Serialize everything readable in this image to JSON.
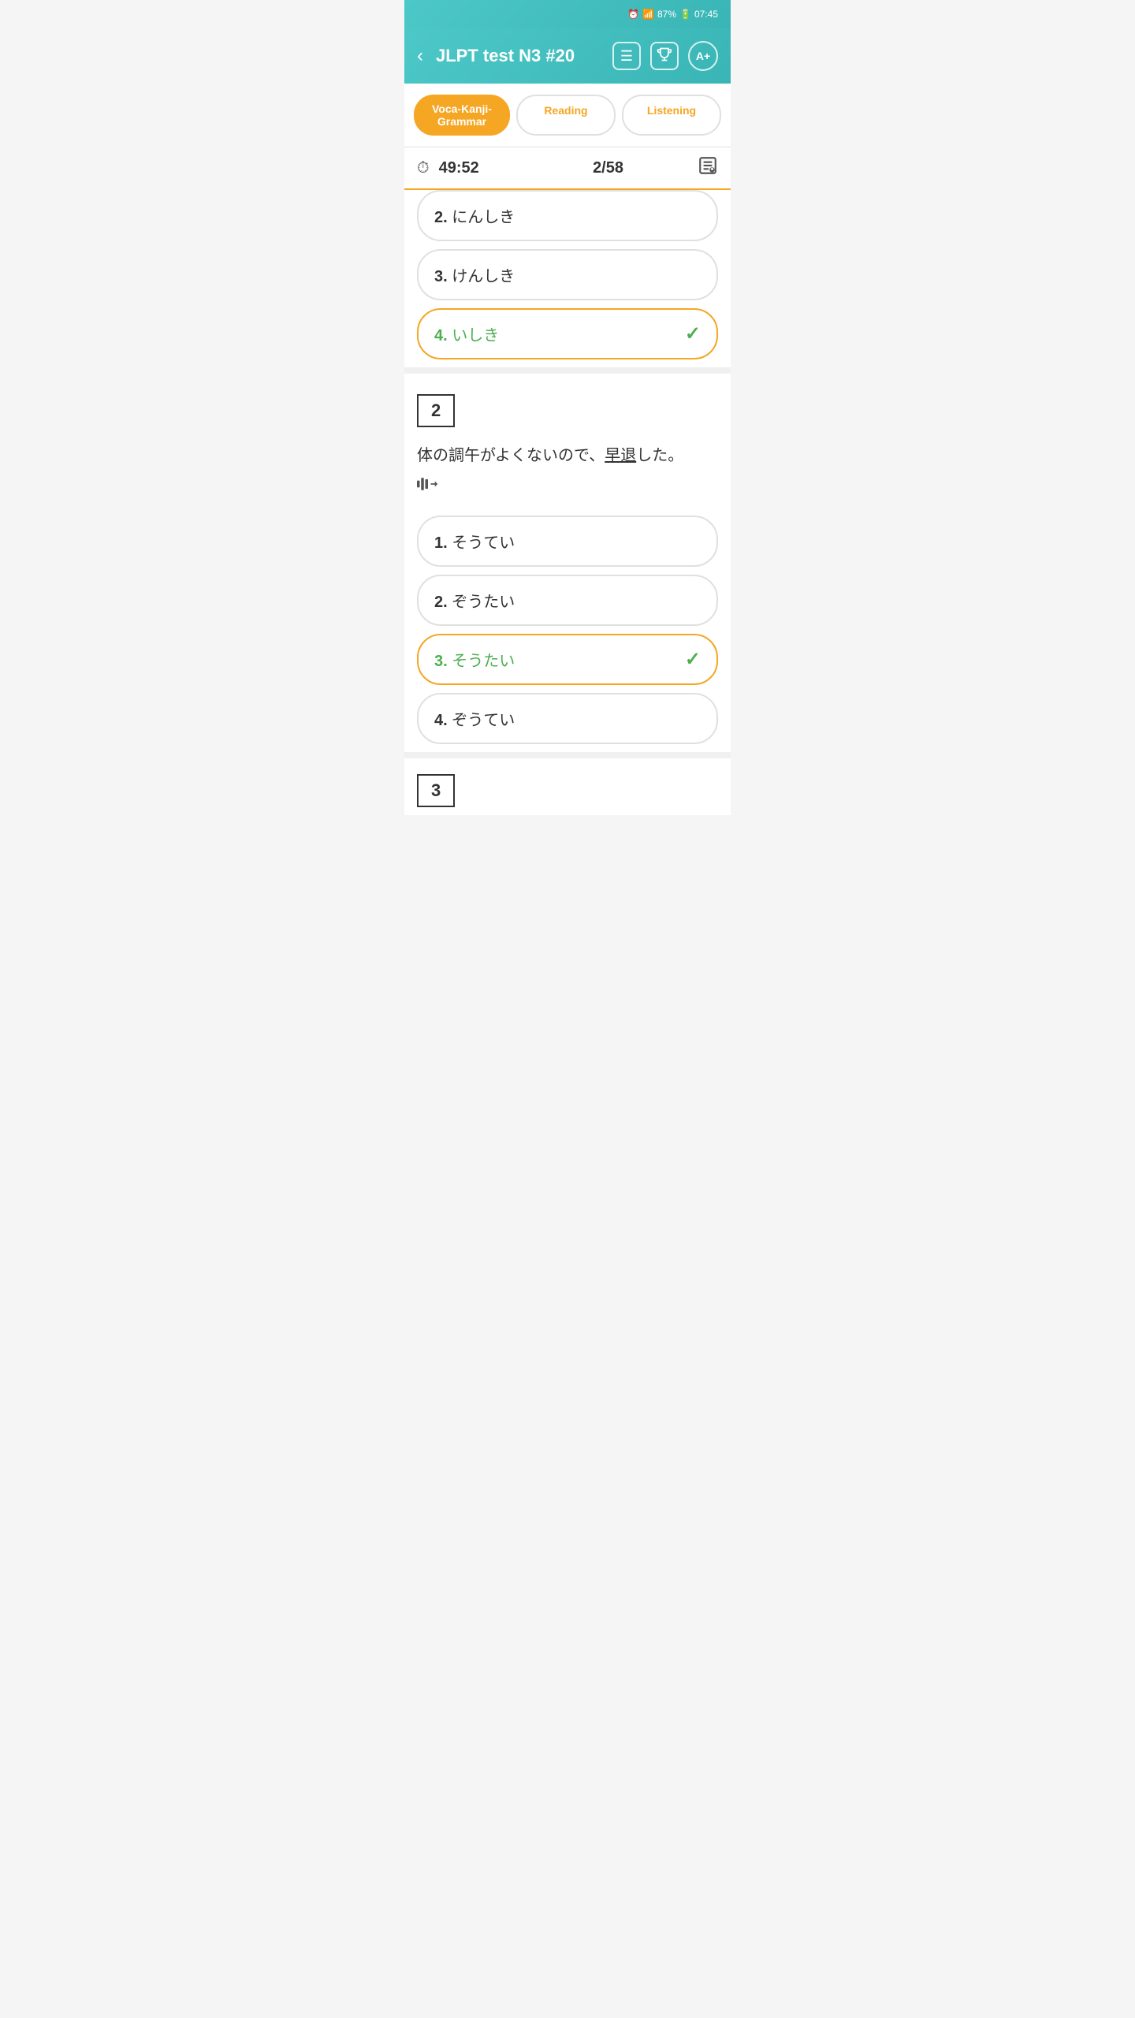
{
  "statusBar": {
    "battery": "87%",
    "time": "07:45"
  },
  "header": {
    "title": "JLPT test N3 #20",
    "backLabel": "<",
    "noteIcon": "≡",
    "trophyIcon": "🏆",
    "fontIcon": "A+"
  },
  "tabs": [
    {
      "label": "Voca-Kanji-Grammar",
      "active": true
    },
    {
      "label": "Reading",
      "active": false
    },
    {
      "label": "Listening",
      "active": false
    }
  ],
  "timerRow": {
    "time": "49:52",
    "questionCount": "2/58"
  },
  "question1": {
    "options": [
      {
        "number": "2.",
        "text": "にんしき",
        "selected": false,
        "partial": true
      },
      {
        "number": "3.",
        "text": "けんしき",
        "selected": false
      },
      {
        "number": "4.",
        "text": "いしき",
        "selected": true,
        "checkmark": "✓"
      }
    ]
  },
  "question2": {
    "number": "2",
    "text": "体の調午がよくないので、",
    "underlinedText": "早退",
    "textSuffix": "した。",
    "options": [
      {
        "number": "1.",
        "text": "そうてい",
        "selected": false
      },
      {
        "number": "2.",
        "text": "ぞうたい",
        "selected": false
      },
      {
        "number": "3.",
        "text": "そうたい",
        "selected": true,
        "checkmark": "✓"
      },
      {
        "number": "4.",
        "text": "ぞうてい",
        "selected": false
      }
    ]
  },
  "question3": {
    "number": "3",
    "partial": true
  }
}
